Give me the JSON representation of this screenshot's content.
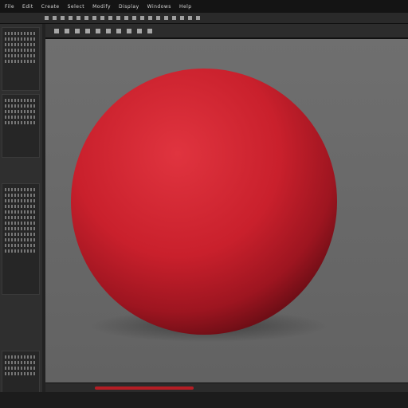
{
  "menu": {
    "items": [
      "File",
      "Edit",
      "Create",
      "Select",
      "Modify",
      "Display",
      "Windows",
      "Help"
    ]
  },
  "toolbar": {
    "title": "",
    "icons": [
      "select-icon",
      "move-icon",
      "rotate-icon",
      "scale-icon",
      "snap-icon",
      "render-icon",
      "camera-icon",
      "grid-icon",
      "light-icon"
    ]
  },
  "panel": {
    "sections": [
      "",
      "",
      "",
      ""
    ]
  },
  "viewport": {
    "object": "sphere",
    "object_color": "#d42a36",
    "background": "#6a6a6a"
  },
  "status": {
    "text": ""
  },
  "colors": {
    "accent": "#b41d24"
  }
}
